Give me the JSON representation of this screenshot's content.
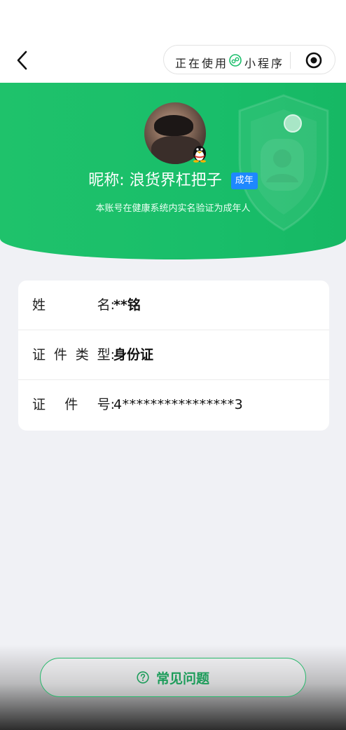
{
  "nav": {
    "capsule_text_1": "正在使用",
    "capsule_text_2": "小程序",
    "back_icon": "chevron-left-icon",
    "mini_program_icon": "mini-program-icon",
    "more_icon": "target-icon"
  },
  "profile": {
    "nickname_label": "昵称:",
    "nickname": "浪货界杠把子",
    "badge": "成年",
    "verify_note": "本账号在健康系统内实名验证为成年人",
    "avatar_badge_icon": "qq-penguin-icon"
  },
  "info_rows": [
    {
      "label_chars": [
        "姓",
        "名:"
      ],
      "value": "**铭"
    },
    {
      "label_chars": [
        "证",
        "件",
        "类",
        "型:"
      ],
      "value": "身份证"
    },
    {
      "label_chars": [
        "证",
        "件",
        "号:"
      ],
      "value": "4****************3"
    }
  ],
  "faq": {
    "label": "常见问题",
    "icon": "question-circle-icon"
  },
  "colors": {
    "brand_green": "#1fc26b",
    "badge_blue": "#1e88ff",
    "faq_green": "#1d9c5a",
    "page_bg": "#f0f1f5"
  }
}
